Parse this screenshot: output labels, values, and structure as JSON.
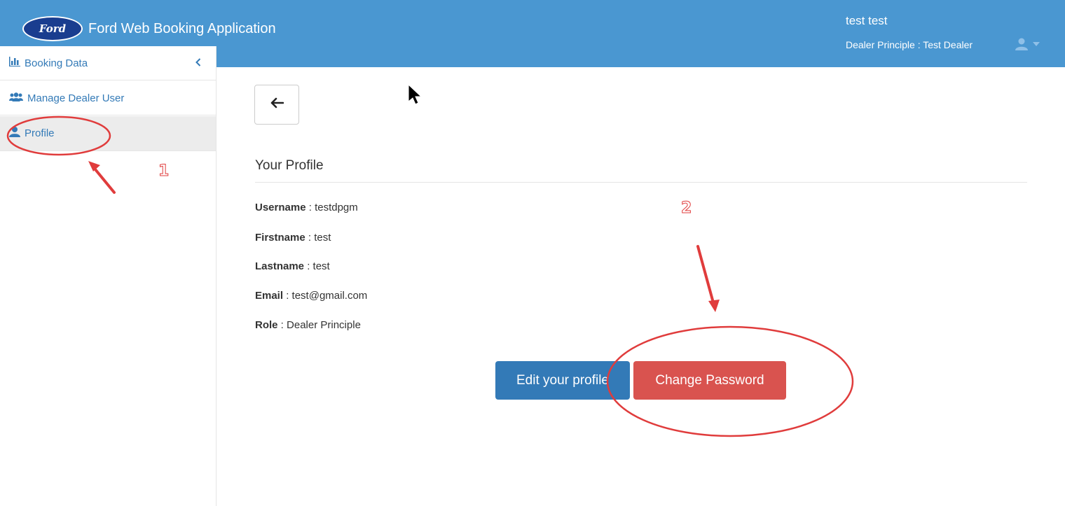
{
  "header": {
    "logo_text": "Ford",
    "app_title": "Ford Web Booking Application",
    "user_name": "test test",
    "user_role": "Dealer Principle : Test Dealer",
    "icons": {
      "user": "user-icon",
      "caret": "caret-down-icon"
    }
  },
  "sidebar": {
    "items": [
      {
        "label": "Booking Data",
        "icon": "bar-chart-icon"
      },
      {
        "label": "Manage Dealer User",
        "icon": "users-icon"
      },
      {
        "label": "Profile",
        "icon": "user-icon",
        "active": true
      }
    ],
    "collapse_icon": "chevron-left-icon"
  },
  "main": {
    "back_icon": "arrow-left-icon",
    "section_title": "Your Profile",
    "fields": [
      {
        "label": "Username",
        "value": "testdpgm"
      },
      {
        "label": "Firstname",
        "value": "test"
      },
      {
        "label": "Lastname",
        "value": "test"
      },
      {
        "label": "Email",
        "value": "test@gmail.com"
      },
      {
        "label": "Role",
        "value": "Dealer Principle"
      }
    ],
    "separator": " : ",
    "edit_button": "Edit your profile",
    "change_password_button": "Change Password"
  },
  "annotations": {
    "step_1": "1",
    "step_2": "2"
  },
  "colors": {
    "header_bg": "#4a97d1",
    "primary": "#337ab7",
    "danger": "#d9534f",
    "annotation": "#e03c3c"
  }
}
